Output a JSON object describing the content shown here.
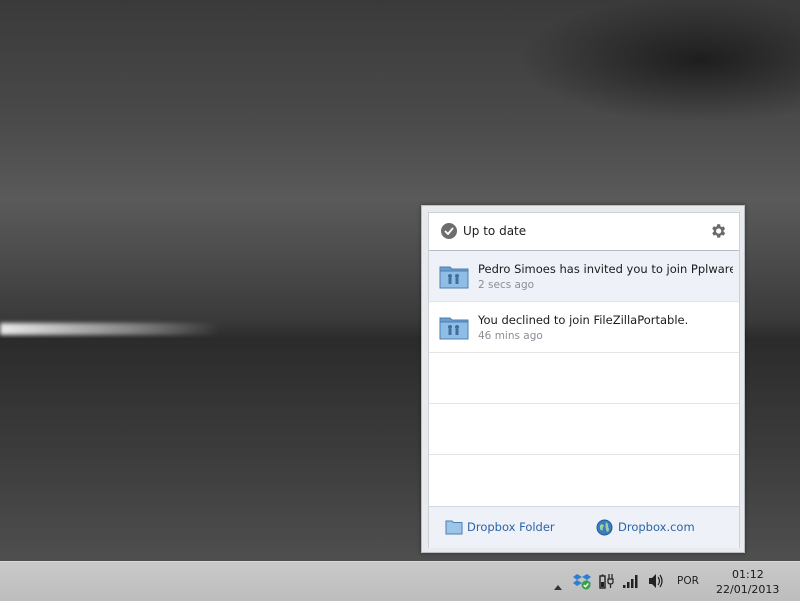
{
  "popup": {
    "status": "Up to date",
    "notifications": [
      {
        "title": "Pedro Simoes has invited you to join Pplware_...",
        "time": "2 secs ago",
        "highlighted": true
      },
      {
        "title": "You declined to join FileZillaPortable.",
        "time": "46 mins ago",
        "highlighted": false
      }
    ],
    "footer": {
      "folder_label": "Dropbox Folder",
      "site_label": "Dropbox.com"
    }
  },
  "taskbar": {
    "language": "POR",
    "time": "01:12",
    "date": "22/01/2013"
  },
  "colors": {
    "link": "#2a64a8",
    "highlight_row": "#eef1f7",
    "folder_blue": "#7fb1dd"
  }
}
